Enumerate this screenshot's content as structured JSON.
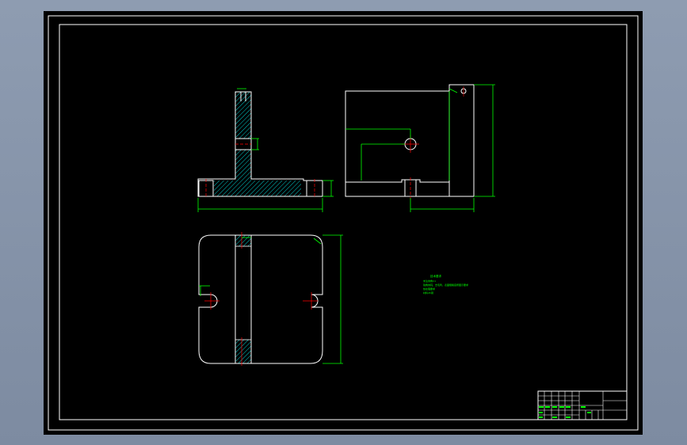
{
  "drawing": {
    "background": "#000000",
    "line_color": "#ffffff",
    "dimension_color": "#00ff00",
    "center_color": "#ff0000",
    "hatch_color": "#00cccc"
  },
  "notes": {
    "heading": "技术要求",
    "lines": [
      "未注倒角C1",
      "锐角倒钝，去毛刺，表面粗糙度按图示要求",
      "热处理要求",
      "材料45钢"
    ]
  },
  "title_block": {
    "cells": [
      "",
      "",
      "",
      "",
      "",
      ""
    ]
  }
}
